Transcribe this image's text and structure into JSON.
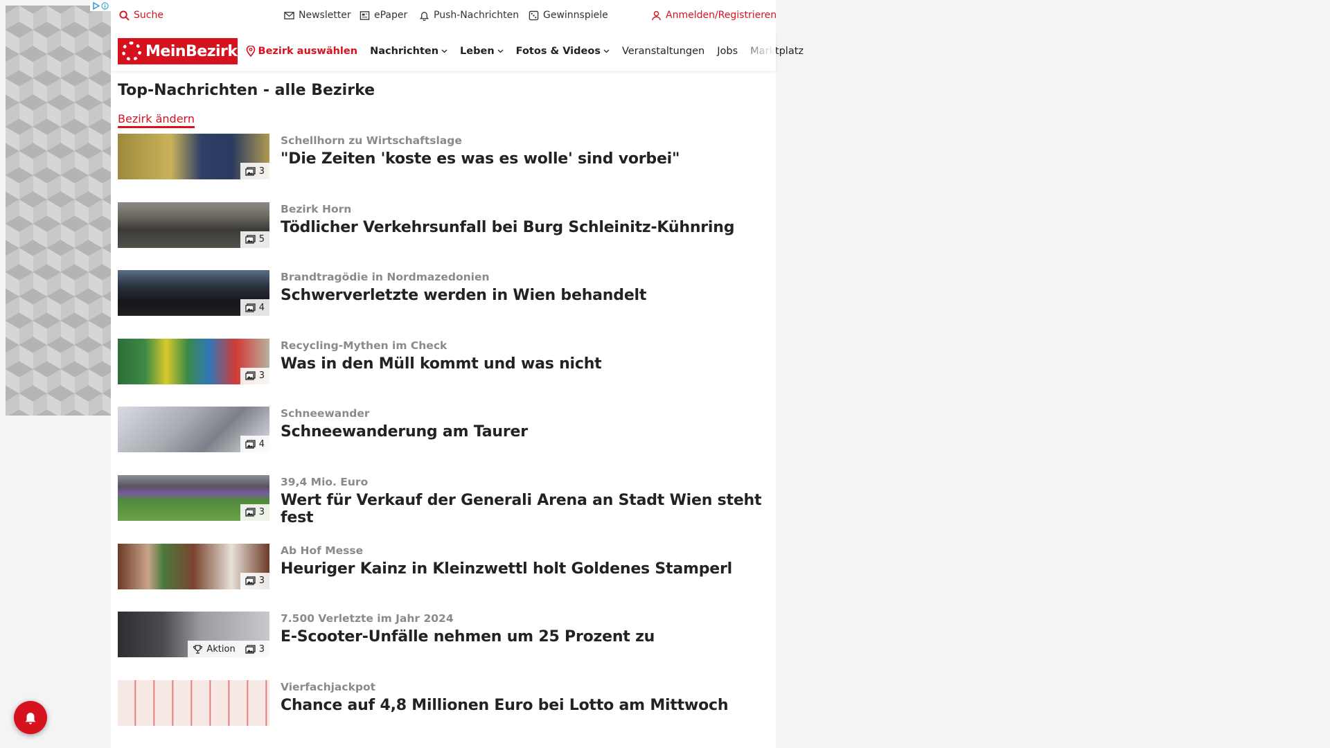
{
  "ad": {
    "choices_icons": "ad-choices-icon"
  },
  "utility": {
    "search": "Suche",
    "newsletter": "Newsletter",
    "epaper": "ePaper",
    "push": "Push-Nachrichten",
    "gewinnspiele": "Gewinnspiele",
    "login": "Anmelden/Registrieren"
  },
  "nav": {
    "logo": "MeinBezirk",
    "select_district": "Bezirk auswählen",
    "items": [
      "Nachrichten",
      "Leben",
      "Fotos & Videos",
      "Veranstaltungen",
      "Jobs",
      "Marktplatz"
    ]
  },
  "section": {
    "title": "Top-Nachrichten - alle Bezirke",
    "change": "Bezirk ändern"
  },
  "articles": [
    {
      "kicker": "Schellhorn zu Wirtschaftslage",
      "headline": "\"Die Zeiten 'koste es was es wolle' sind vorbei\"",
      "photos": "3",
      "action": ""
    },
    {
      "kicker": "Bezirk Horn",
      "headline": "Tödlicher Verkehrsunfall bei Burg Schleinitz-Kühnring",
      "photos": "5",
      "action": ""
    },
    {
      "kicker": "Brandtragödie in Nordmazedonien",
      "headline": "Schwerverletzte werden in Wien behandelt",
      "photos": "4",
      "action": ""
    },
    {
      "kicker": "Recycling-Mythen im Check",
      "headline": "Was in den Müll kommt und was nicht",
      "photos": "3",
      "action": ""
    },
    {
      "kicker": "Schneewander",
      "headline": "Schneewanderung am Taurer",
      "photos": "4",
      "action": ""
    },
    {
      "kicker": "39,4 Mio. Euro",
      "headline": "Wert für Verkauf der Generali Arena an Stadt Wien steht fest",
      "photos": "3",
      "action": ""
    },
    {
      "kicker": "Ab Hof Messe",
      "headline": "Heuriger Kainz in Kleinzwettl holt Goldenes Stamperl",
      "photos": "3",
      "action": ""
    },
    {
      "kicker": "7.500 Verletzte im Jahr 2024",
      "headline": "E-Scooter-Unfälle nehmen um 25 Prozent zu",
      "photos": "3",
      "action": "Aktion"
    },
    {
      "kicker": "Vierfachjackpot",
      "headline": "Chance auf 4,8 Millionen Euro bei Lotto am Mittwoch",
      "photos": "",
      "action": ""
    }
  ],
  "colors": {
    "brand_red": "#d6121f"
  }
}
